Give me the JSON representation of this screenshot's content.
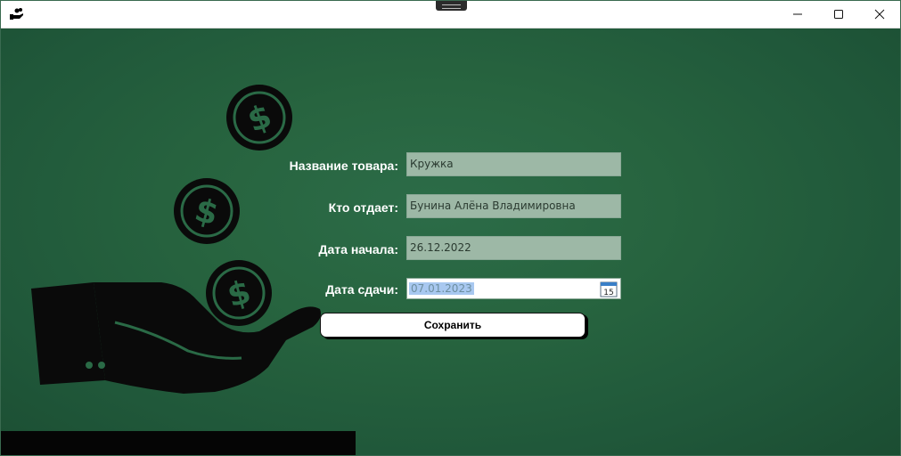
{
  "window": {
    "icon": "money-hand-icon",
    "controls": {
      "minimize": "minimize-icon",
      "maximize": "maximize-icon",
      "close": "close-icon"
    }
  },
  "form": {
    "product_name": {
      "label": "Название товара:",
      "value": "Кружка"
    },
    "giver": {
      "label": "Кто отдает:",
      "value": "Бунина Алёна Владимировна"
    },
    "start_date": {
      "label": "Дата начала:",
      "value": "26.12.2022"
    },
    "return_date": {
      "label": "Дата сдачи:",
      "value": "07.01.2023",
      "calendar_day": "15"
    },
    "save_label": "Сохранить"
  },
  "colors": {
    "background": "#27643f",
    "field_bg": "#9db8a6",
    "label_text": "#ffffff",
    "illustration": "#0a0a0a"
  }
}
